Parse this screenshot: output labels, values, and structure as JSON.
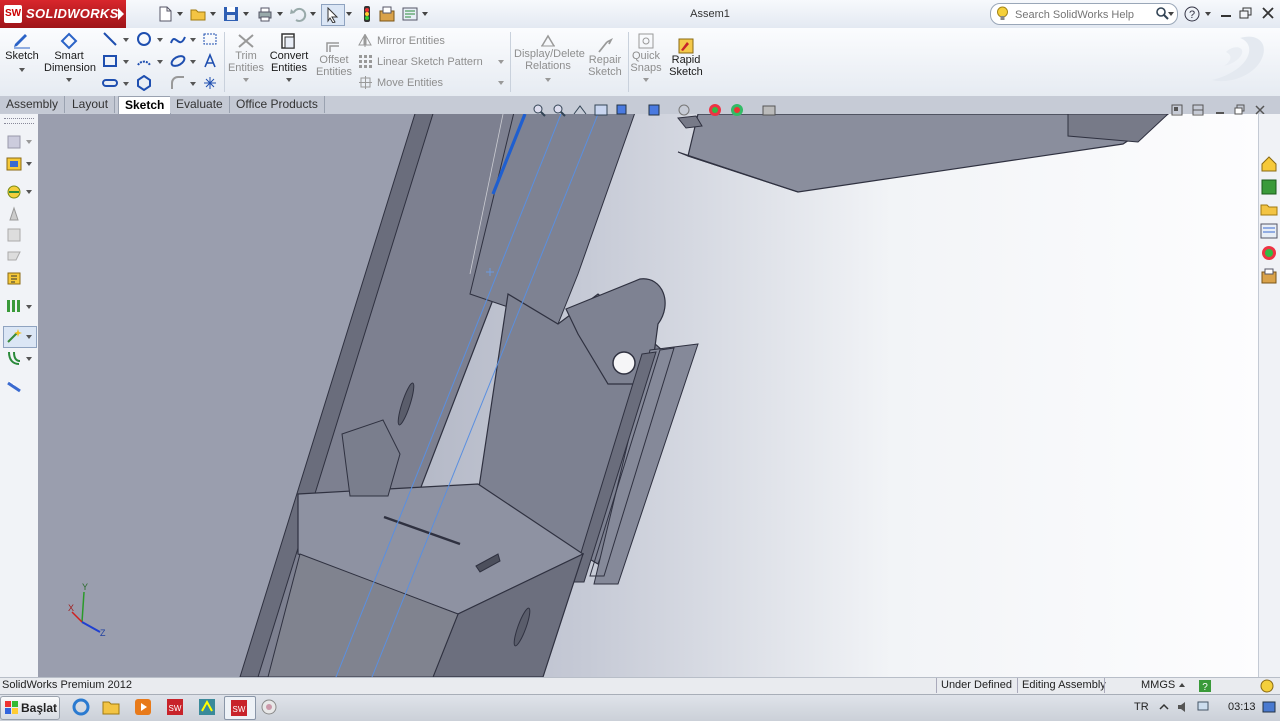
{
  "app": {
    "logo_text": "SOLIDWORKS",
    "document_title": "Assem1"
  },
  "search": {
    "placeholder": "Search SolidWorks Help"
  },
  "help": {
    "icon": "question-icon"
  },
  "commands": {
    "sketch": "Sketch",
    "smart_dimension": [
      "Smart",
      "Dimension"
    ],
    "trim_entities": [
      "Trim",
      "Entities"
    ],
    "convert_entities": [
      "Convert",
      "Entities"
    ],
    "offset_entities": [
      "Offset",
      "Entities"
    ],
    "mirror_entities": "Mirror Entities",
    "linear_sketch_pattern": "Linear Sketch Pattern",
    "move_entities": "Move Entities",
    "display_delete_relations": [
      "Display/Delete",
      "Relations"
    ],
    "repair_sketch": [
      "Repair",
      "Sketch"
    ],
    "quick_snaps": [
      "Quick",
      "Snaps"
    ],
    "rapid_sketch": [
      "Rapid",
      "Sketch"
    ]
  },
  "tabs": [
    {
      "label": "Assembly",
      "active": false
    },
    {
      "label": "Layout",
      "active": false
    },
    {
      "label": "Sketch",
      "active": true
    },
    {
      "label": "Evaluate",
      "active": false
    },
    {
      "label": "Office Products",
      "active": false
    }
  ],
  "triad": {
    "x": "X",
    "y": "Y",
    "z": "Z"
  },
  "status": {
    "product": "SolidWorks Premium 2012",
    "sketch_state": "Under Defined",
    "mode": "Editing Assembly",
    "units": "MMGS"
  },
  "taskbar": {
    "start_label": "Başlat",
    "language": "TR",
    "clock": "03:13"
  },
  "colors": {
    "accent_red": "#c8232a",
    "model_gray": "#7f8291",
    "sketch_blue": "#1f5fd0"
  }
}
